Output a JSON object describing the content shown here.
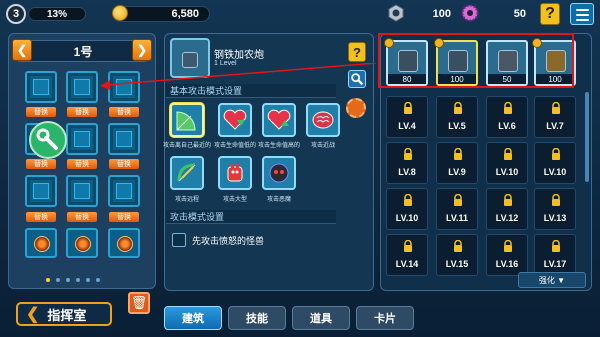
{
  "topbar": {
    "level": "3",
    "xp_percent_label": "13%",
    "xp_progress": 0.13,
    "coins": "6,580",
    "nuts": "100",
    "gears": "50",
    "help_label": "?"
  },
  "left": {
    "title": "1号",
    "swap_label": "替换",
    "slots": [
      {
        "swap": "替换"
      },
      {
        "swap": "替换"
      },
      {
        "swap": "替换"
      },
      {
        "swap": "替换"
      },
      {
        "swap": "替换"
      },
      {
        "swap": "替换"
      },
      {
        "swap": "替换"
      },
      {
        "swap": "替换"
      },
      {
        "swap": "替换"
      }
    ],
    "page_count": 6,
    "active_page": 0
  },
  "bottom": {
    "hq_label": "指挥室",
    "tabs": [
      {
        "label": "建筑",
        "active": true
      },
      {
        "label": "技能",
        "active": false
      },
      {
        "label": "道具",
        "active": false
      },
      {
        "label": "卡片",
        "active": false
      }
    ]
  },
  "middle": {
    "turret_name": "钢铁加农炮",
    "turret_level": "1 Level",
    "help_label": "?",
    "section1_title": "基本攻击模式设置",
    "skills": [
      {
        "icon": "radar-icon",
        "label": "攻击离自己最近的"
      },
      {
        "icon": "heart-down-icon",
        "label": "攻击生命值低的"
      },
      {
        "icon": "heart-up-icon",
        "label": "攻击生命值高的"
      },
      {
        "icon": "brain-icon",
        "label": "攻击近战"
      },
      {
        "icon": "bow-icon",
        "label": "攻击远程"
      },
      {
        "icon": "big-monster-icon",
        "label": "攻击大型"
      },
      {
        "icon": "skull-icon",
        "label": "攻击恶魔"
      }
    ],
    "section2_title": "攻击模式设置",
    "checkbox_label": "先攻击愤怒的怪兽"
  },
  "right": {
    "units": [
      {
        "icon": "cannon-icon",
        "count": "80"
      },
      {
        "icon": "cannon-icon",
        "count": "100"
      },
      {
        "icon": "crate-icon",
        "count": "50"
      },
      {
        "icon": "tesla-icon",
        "count": "100"
      }
    ],
    "locked": [
      "LV.4",
      "LV.5",
      "LV.6",
      "LV.7",
      "LV.8",
      "LV.9",
      "LV.10",
      "LV.10",
      "LV.10",
      "LV.11",
      "LV.12",
      "LV.13",
      "LV.14",
      "LV.15",
      "LV.16",
      "LV.17"
    ],
    "strengthen_label": "强化 ▼"
  },
  "colors": {
    "background": "#0e2a44",
    "accent_orange": "#f0a020",
    "highlight_red": "#e11515",
    "tab_active": "#1a86cf"
  }
}
